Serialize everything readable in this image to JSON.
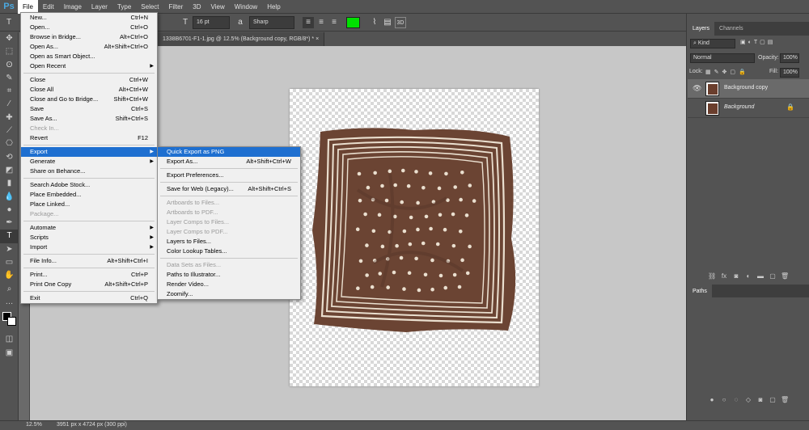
{
  "app": {
    "logo": "Ps"
  },
  "menubar": [
    "File",
    "Edit",
    "Image",
    "Layer",
    "Type",
    "Select",
    "Filter",
    "3D",
    "View",
    "Window",
    "Help"
  ],
  "options": {
    "font_size": "16 pt",
    "antialias": "Sharp",
    "size_icon": "T",
    "color": "#00e000"
  },
  "document": {
    "tab_title": "1338B6701-F1-1.jpg @ 12.5% (Background copy, RGB/8*) *"
  },
  "file_menu": [
    {
      "label": "New...",
      "shortcut": "Ctrl+N"
    },
    {
      "label": "Open...",
      "shortcut": "Ctrl+O"
    },
    {
      "label": "Browse in Bridge...",
      "shortcut": "Alt+Ctrl+O"
    },
    {
      "label": "Open As...",
      "shortcut": "Alt+Shift+Ctrl+O"
    },
    {
      "label": "Open as Smart Object...",
      "shortcut": ""
    },
    {
      "label": "Open Recent",
      "shortcut": "",
      "submenu": true
    },
    {
      "sep": true
    },
    {
      "label": "Close",
      "shortcut": "Ctrl+W"
    },
    {
      "label": "Close All",
      "shortcut": "Alt+Ctrl+W"
    },
    {
      "label": "Close and Go to Bridge...",
      "shortcut": "Shift+Ctrl+W"
    },
    {
      "label": "Save",
      "shortcut": "Ctrl+S"
    },
    {
      "label": "Save As...",
      "shortcut": "Shift+Ctrl+S"
    },
    {
      "label": "Check In...",
      "shortcut": "",
      "disabled": true
    },
    {
      "label": "Revert",
      "shortcut": "F12"
    },
    {
      "sep": true
    },
    {
      "label": "Export",
      "shortcut": "",
      "submenu": true,
      "highlighted": true
    },
    {
      "label": "Generate",
      "shortcut": "",
      "submenu": true
    },
    {
      "label": "Share on Behance...",
      "shortcut": ""
    },
    {
      "sep": true
    },
    {
      "label": "Search Adobe Stock...",
      "shortcut": ""
    },
    {
      "label": "Place Embedded...",
      "shortcut": ""
    },
    {
      "label": "Place Linked...",
      "shortcut": ""
    },
    {
      "label": "Package...",
      "shortcut": "",
      "disabled": true
    },
    {
      "sep": true
    },
    {
      "label": "Automate",
      "shortcut": "",
      "submenu": true
    },
    {
      "label": "Scripts",
      "shortcut": "",
      "submenu": true
    },
    {
      "label": "Import",
      "shortcut": "",
      "submenu": true
    },
    {
      "sep": true
    },
    {
      "label": "File Info...",
      "shortcut": "Alt+Shift+Ctrl+I"
    },
    {
      "sep": true
    },
    {
      "label": "Print...",
      "shortcut": "Ctrl+P"
    },
    {
      "label": "Print One Copy",
      "shortcut": "Alt+Shift+Ctrl+P"
    },
    {
      "sep": true
    },
    {
      "label": "Exit",
      "shortcut": "Ctrl+Q"
    }
  ],
  "export_menu": [
    {
      "label": "Quick Export as PNG",
      "shortcut": "",
      "highlighted": true
    },
    {
      "label": "Export As...",
      "shortcut": "Alt+Shift+Ctrl+W"
    },
    {
      "sep": true
    },
    {
      "label": "Export Preferences...",
      "shortcut": ""
    },
    {
      "sep": true
    },
    {
      "label": "Save for Web (Legacy)...",
      "shortcut": "Alt+Shift+Ctrl+S"
    },
    {
      "sep": true
    },
    {
      "label": "Artboards to Files...",
      "shortcut": "",
      "disabled": true
    },
    {
      "label": "Artboards to PDF...",
      "shortcut": "",
      "disabled": true
    },
    {
      "label": "Layer Comps to Files...",
      "shortcut": "",
      "disabled": true
    },
    {
      "label": "Layer Comps to PDF...",
      "shortcut": "",
      "disabled": true
    },
    {
      "label": "Layers to Files...",
      "shortcut": ""
    },
    {
      "label": "Color Lookup Tables...",
      "shortcut": ""
    },
    {
      "sep": true
    },
    {
      "label": "Data Sets as Files...",
      "shortcut": "",
      "disabled": true
    },
    {
      "label": "Paths to Illustrator...",
      "shortcut": ""
    },
    {
      "label": "Render Video...",
      "shortcut": ""
    },
    {
      "label": "Zoomify...",
      "shortcut": ""
    }
  ],
  "layers_panel": {
    "tabs": [
      "Layers",
      "Channels"
    ],
    "filter_label": "Kind",
    "blend_mode": "Normal",
    "opacity_label": "Opacity:",
    "opacity_value": "100%",
    "lock_label": "Lock:",
    "fill_label": "Fill:",
    "fill_value": "100%",
    "layers": [
      {
        "name": "Background copy",
        "visible": true,
        "selected": true
      },
      {
        "name": "Background",
        "visible": false,
        "locked": true
      }
    ]
  },
  "paths_panel": {
    "title": "Paths"
  },
  "status": {
    "zoom": "12.5%",
    "doc_size": "3951 px x 4724 px (300 ppi)"
  }
}
